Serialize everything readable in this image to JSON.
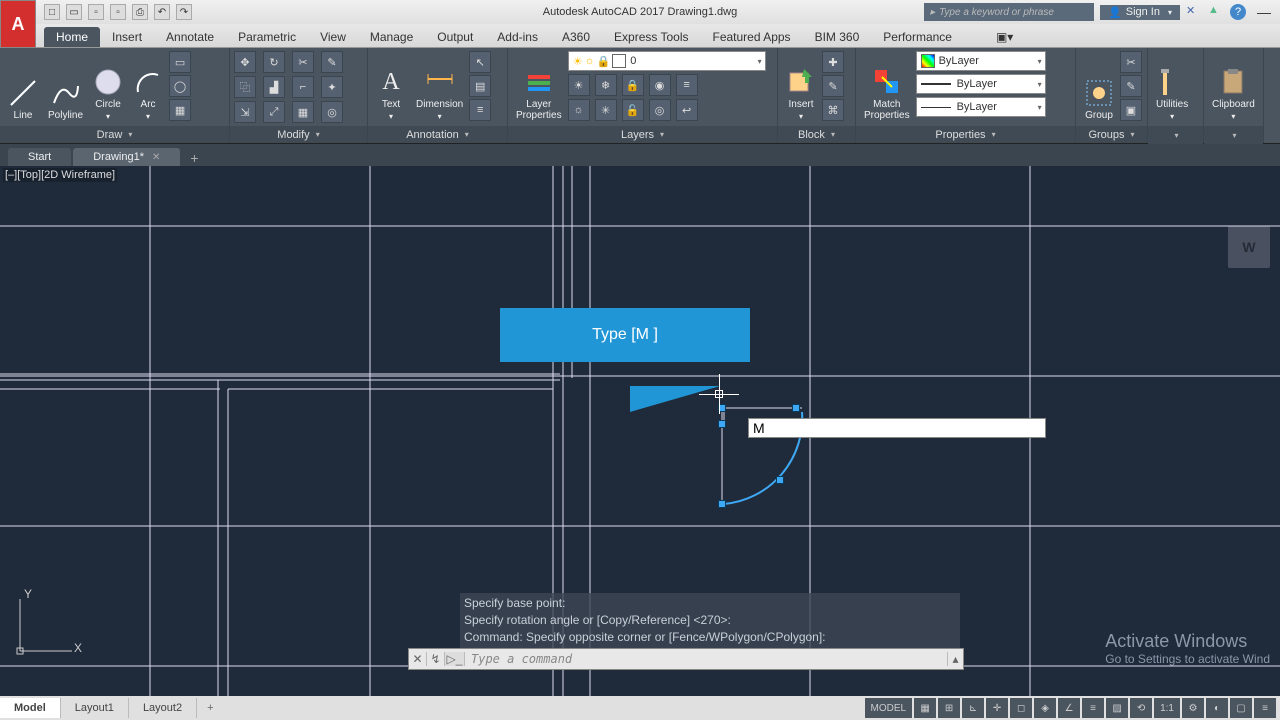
{
  "app": {
    "title": "Autodesk AutoCAD 2017   Drawing1.dwg",
    "search_placeholder": "Type a keyword or phrase",
    "signin": "Sign In"
  },
  "tabs": [
    "Home",
    "Insert",
    "Annotate",
    "Parametric",
    "View",
    "Manage",
    "Output",
    "Add-ins",
    "A360",
    "Express Tools",
    "Featured Apps",
    "BIM 360",
    "Performance"
  ],
  "active_tab": "Home",
  "ribbon": {
    "draw": {
      "title": "Draw",
      "line": "Line",
      "polyline": "Polyline",
      "circle": "Circle",
      "arc": "Arc"
    },
    "modify": {
      "title": "Modify"
    },
    "annotation": {
      "title": "Annotation",
      "text": "Text",
      "dimension": "Dimension"
    },
    "layers": {
      "title": "Layers",
      "props": "Layer\nProperties",
      "current": "0"
    },
    "block": {
      "title": "Block",
      "insert": "Insert"
    },
    "properties": {
      "title": "Properties",
      "match": "Match\nProperties",
      "color": "ByLayer",
      "lw": "ByLayer",
      "lt": "ByLayer"
    },
    "groups": {
      "title": "Groups",
      "group": "Group"
    },
    "utilities": {
      "title": "",
      "label": "Utilities"
    },
    "clipboard": {
      "title": "",
      "label": "Clipboard"
    }
  },
  "doc_tabs": {
    "start": "Start",
    "current": "Drawing1*"
  },
  "view_label": "[–][Top][2D Wireframe]",
  "tooltip": "Type [M ]",
  "dynamic_input": "M",
  "cmd_history": [
    "Specify base point:",
    "Specify rotation angle or [Copy/Reference] <270>:",
    "Command: Specify opposite corner or [Fence/WPolygon/CPolygon]:"
  ],
  "cmd_placeholder": "Type a command",
  "watermark": {
    "t1": "Activate Windows",
    "t2": "Go to Settings to activate Wind"
  },
  "bottom_tabs": [
    "Model",
    "Layout1",
    "Layout2"
  ],
  "status": {
    "model": "MODEL",
    "scale": "1:1"
  },
  "viewcube": "W",
  "ucs": {
    "x": "X",
    "y": "Y"
  }
}
